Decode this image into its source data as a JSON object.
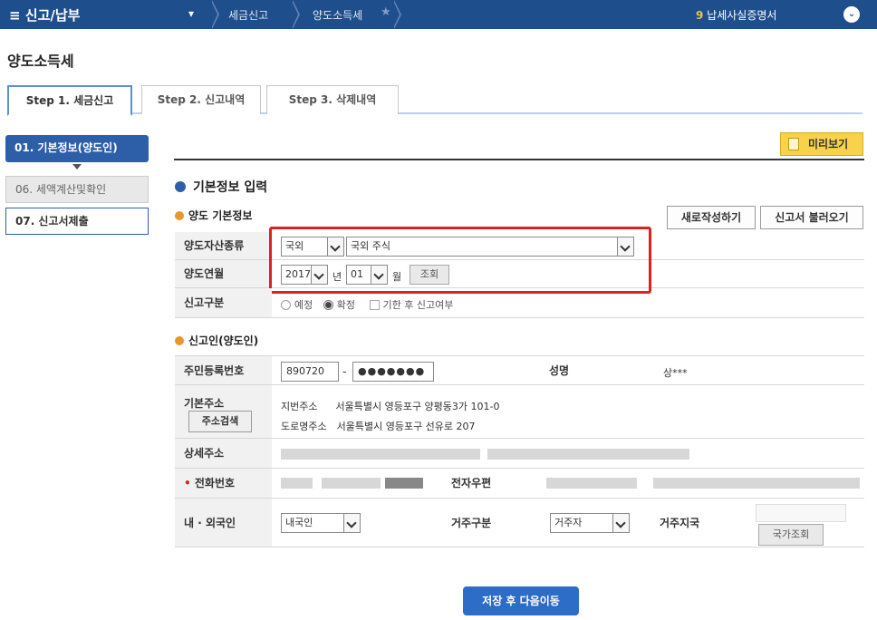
{
  "top": {
    "menu": "≡ 신고/납부",
    "dropdown": "▾",
    "crumb1": "세금신고",
    "crumb2": "양도소득세",
    "right_num": "9",
    "right_label": " 납세사실증명서",
    "right_button": "⌄"
  },
  "page": {
    "title": "양도소득세"
  },
  "tabs": [
    "Step 1. 세금신고",
    "Step 2. 신고내역",
    "Step 3. 삭제내역"
  ],
  "sidebar": [
    "01. 기본정보(양도인)",
    "06. 세액계산및확인",
    "07. 신고서제출"
  ],
  "preview": "미리보기",
  "section": {
    "title": "기본정보 입력",
    "sub1": "양도 기본정보",
    "sub2": "신고인(양도인)"
  },
  "buttons": {
    "new": "새로작성하기",
    "load": "신고서 불러오기",
    "search": "조회",
    "address": "주소검색",
    "country": "국가조회",
    "save": "저장 후 다음이동"
  },
  "form": {
    "asset_label": "양도자산종류",
    "asset_country": "국외",
    "asset_type": "국외 주식",
    "month_label": "양도연월",
    "year": "2017",
    "year_unit": "년",
    "month": "01",
    "month_unit": "월",
    "type_label": "신고구분",
    "opt1": "예정",
    "opt2": "확정",
    "late_label": "기한 후 신고여부",
    "rrn_label": "주민등록번호",
    "rrn1": "890720",
    "rrn2": "●●●●●●●",
    "name_label": "성명",
    "name_value": "상***",
    "address_label": "기본주소",
    "jibun_label": "지번주소",
    "jibun_value": "서울특별시 영등포구 양평동3가 101-0",
    "road_label": "도로명주소",
    "road_value": "서울특별시 영등포구 선유로 207",
    "detail_label": "상세주소",
    "phone_label": "전화번호",
    "email_label": "전자우편",
    "nation_label": "내 · 외국인",
    "nation_value": "내국인",
    "residence_label": "거주구분",
    "residence_value": "거주자",
    "residence_region_label": "거주지국"
  }
}
